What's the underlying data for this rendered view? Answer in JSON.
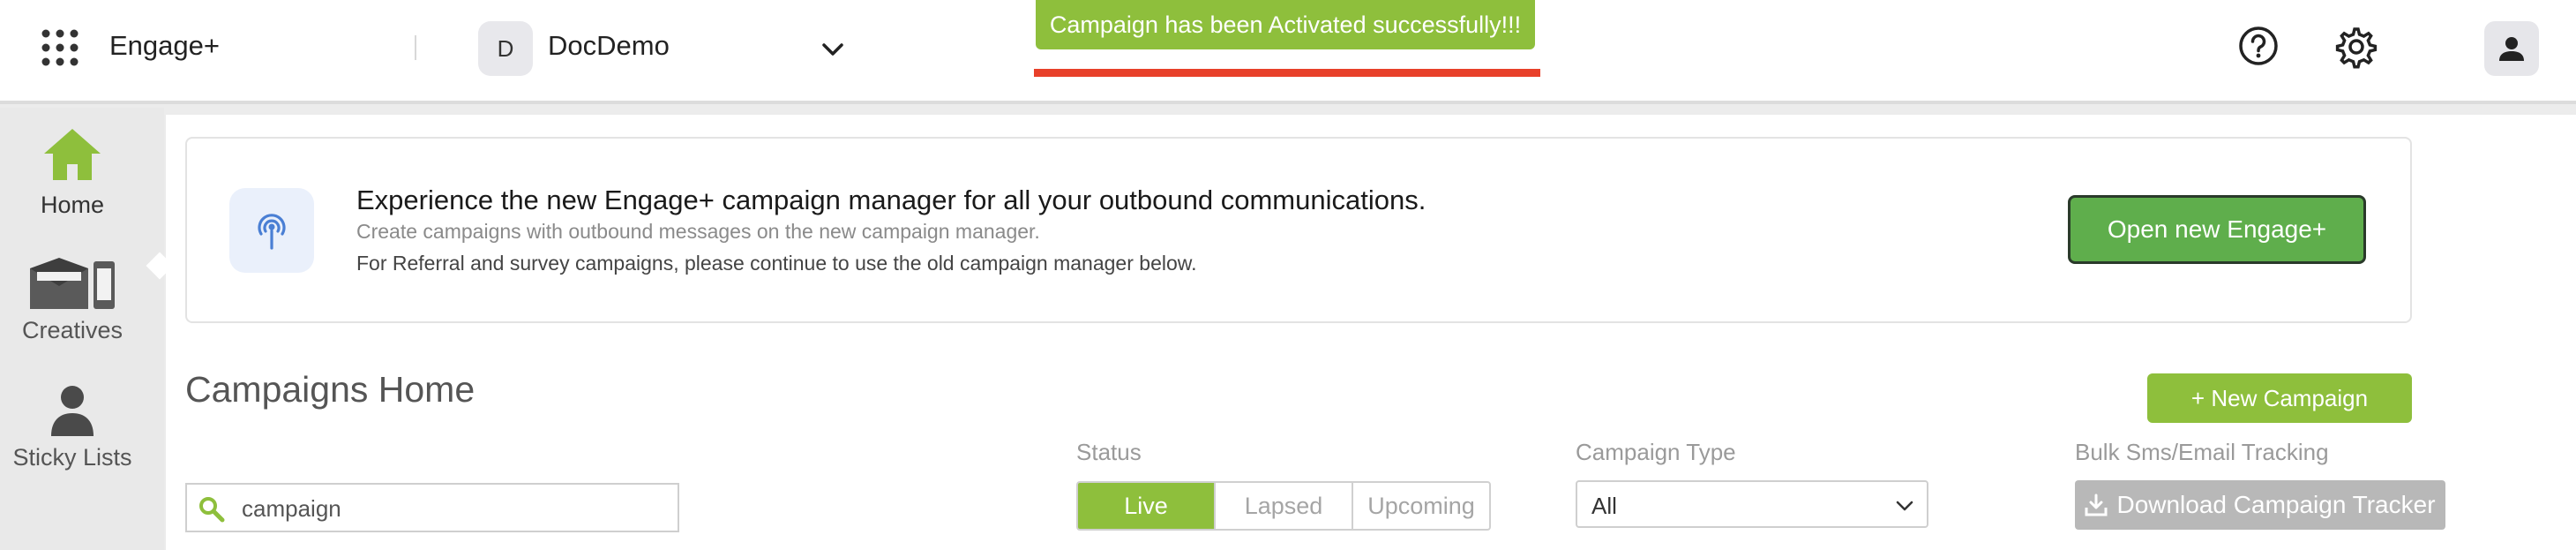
{
  "header": {
    "app_name": "Engage+",
    "org_initial": "D",
    "org_name": "DocDemo",
    "icons": [
      "apps-grid-icon",
      "chevron-down-icon",
      "help-icon",
      "gear-icon",
      "user-icon"
    ]
  },
  "toast": {
    "message": "Campaign has been Activated successfully!!!"
  },
  "sidebar": {
    "items": [
      {
        "label": "Home",
        "icon": "home-icon",
        "active": true
      },
      {
        "label": "Creatives",
        "icon": "creatives-icon"
      },
      {
        "label": "Sticky Lists",
        "icon": "person-icon"
      }
    ]
  },
  "banner": {
    "icon": "broadcast-icon",
    "title": "Experience the new Engage+ campaign manager for all your outbound communications.",
    "subtitle1": "Create campaigns with outbound messages on the new campaign manager.",
    "subtitle2": "For Referral and survey campaigns, please continue to use the old campaign manager below.",
    "button_label": "Open new Engage+"
  },
  "main": {
    "title": "Campaigns Home",
    "new_campaign_label": "+ New Campaign",
    "search": {
      "value": "campaign",
      "icon": "search-icon"
    },
    "status": {
      "label": "Status",
      "options": [
        "Live",
        "Lapsed",
        "Upcoming"
      ],
      "selected": "Live"
    },
    "campaign_type": {
      "label": "Campaign Type",
      "selected": "All"
    },
    "bulk": {
      "label": "Bulk Sms/Email Tracking",
      "button_label": "Download Campaign Tracker",
      "icon": "download-icon"
    }
  },
  "colors": {
    "accent_green": "#8ebf3c",
    "open_button_green": "#5fae4c",
    "toast_underline_red": "#e8402a",
    "disabled_gray": "#b8b8b8"
  }
}
